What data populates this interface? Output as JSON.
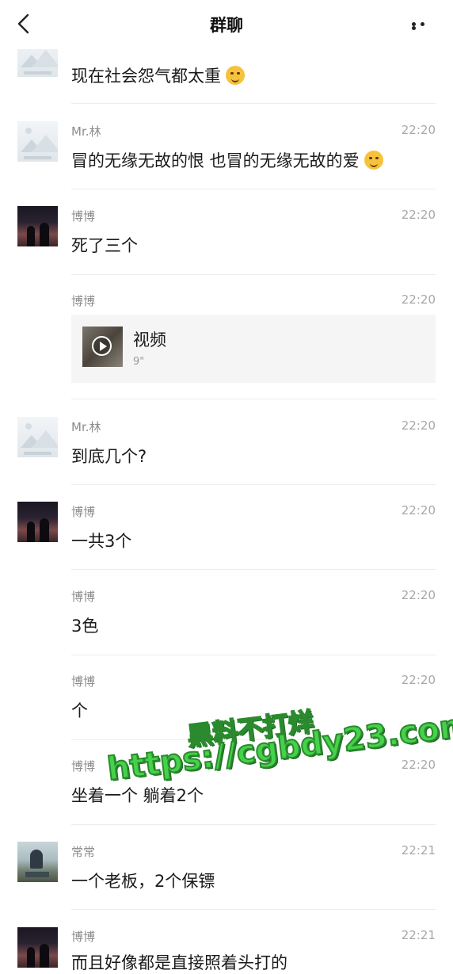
{
  "header": {
    "title": "群聊",
    "back_icon": "chevron-left-icon",
    "more_icon": "more-horizontal-icon"
  },
  "messages": [
    {
      "sender": "",
      "time": "",
      "text": "现在社会怨气都太重",
      "emoji": "laughing-tears-emoji"
    },
    {
      "sender": "Mr.林",
      "time": "22:20",
      "text": "冒的无缘无故的恨  也冒的无缘无故的爱",
      "emoji": "blushing-smile-emoji"
    },
    {
      "sender": "博博",
      "time": "22:20",
      "text": "死了三个"
    },
    {
      "sender": "博博",
      "time": "22:20",
      "video": {
        "title": "视频",
        "duration": "9\""
      }
    },
    {
      "sender": "Mr.林",
      "time": "22:20",
      "text": "到底几个?"
    },
    {
      "sender": "博博",
      "time": "22:20",
      "text": "一共3个"
    },
    {
      "sender": "博博",
      "time": "22:20",
      "text": "3色"
    },
    {
      "sender": "博博",
      "time": "22:20",
      "text": "个"
    },
    {
      "sender": "博博",
      "time": "22:20",
      "text": "坐着一个 躺着2个"
    },
    {
      "sender": "常常",
      "time": "22:21",
      "text": "一个老板，2个保镖"
    },
    {
      "sender": "博博",
      "time": "22:21",
      "text": "而且好像都是直接照着头打的"
    }
  ],
  "watermark": {
    "line1": "黑料不打烊",
    "line2": "https://cgbdy23.com"
  }
}
